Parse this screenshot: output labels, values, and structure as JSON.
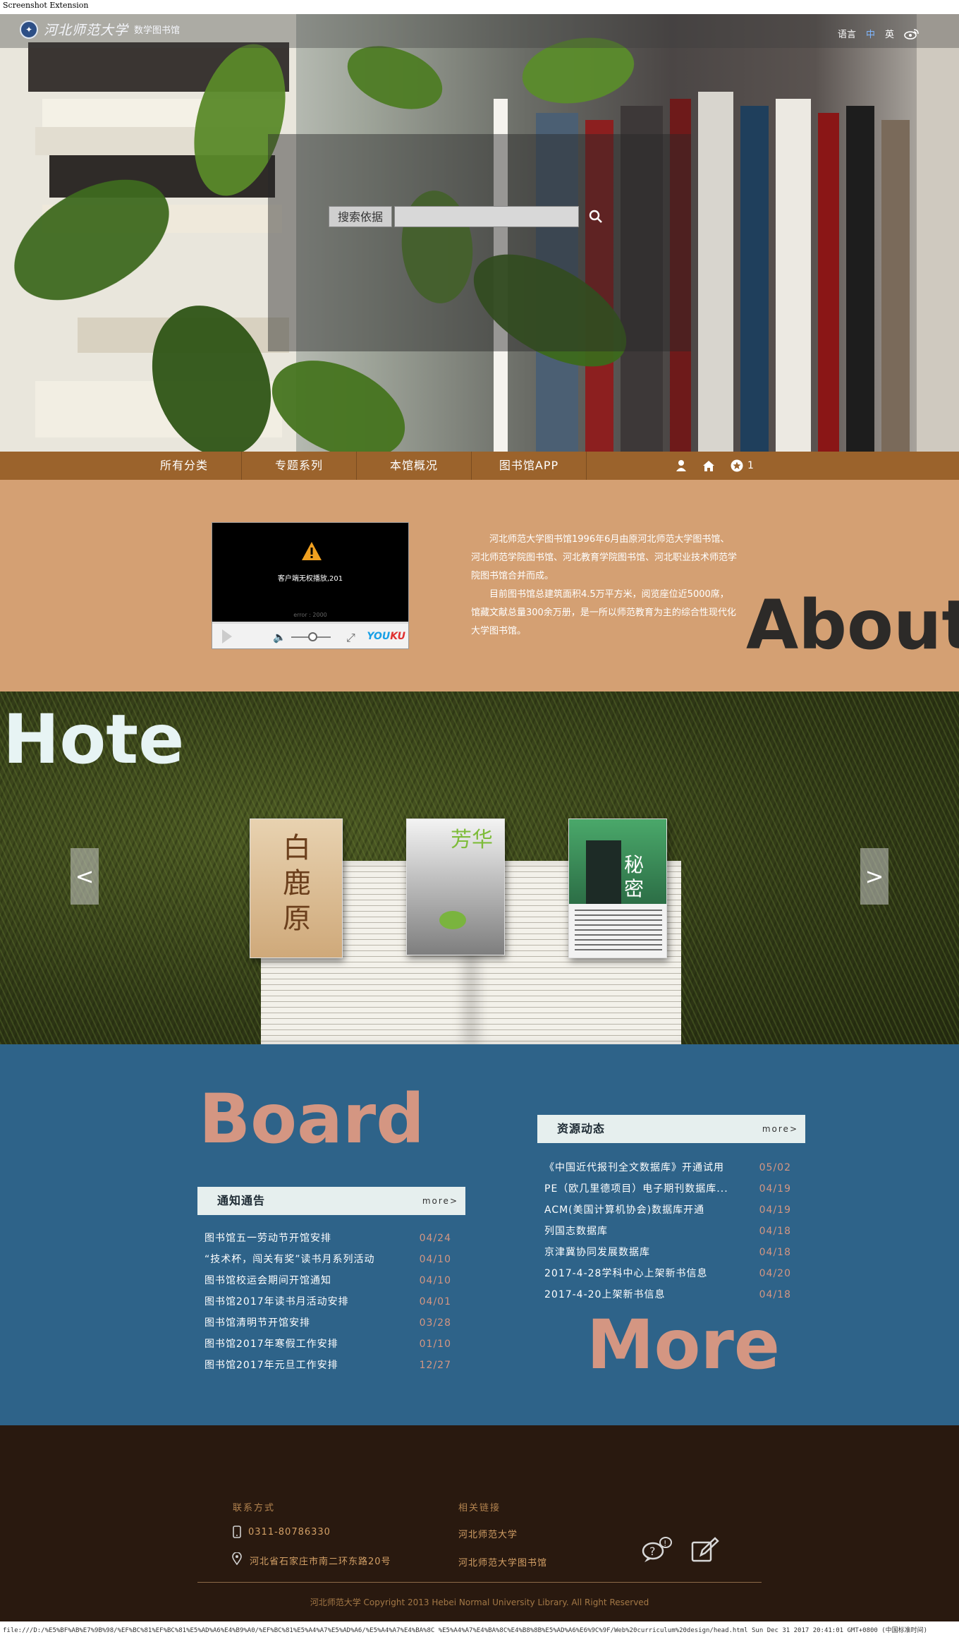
{
  "extension_label": "Screenshot Extension",
  "header": {
    "logo_text": "河北师范大学",
    "logo_sub": "数学图书馆",
    "lang_label": "语言",
    "lang_zh": "中",
    "lang_en": "英"
  },
  "search": {
    "label": "搜索依据",
    "placeholder": ""
  },
  "nav": {
    "items": [
      "所有分类",
      "专题系列",
      "本馆概况",
      "图书馆APP"
    ],
    "favorites_count": "1"
  },
  "about": {
    "title": "About",
    "video_message": "客户端无权播放,201",
    "video_sub": "error : 2000",
    "video_brand_a": "YOU",
    "video_brand_b": "KU",
    "paragraph1": "河北师范大学图书馆1996年6月由原河北师范大学图书馆、河北师范学院图书馆、河北教育学院图书馆、河北职业技术师范学院图书馆合并而成。",
    "paragraph2": "目前图书馆总建筑面积4.5万平方米，阅览座位近5000席，馆藏文献总量300余万册，是一所以师范教育为主的综合性现代化大学图书馆。"
  },
  "hote": {
    "title": "Hote",
    "book1_title": "白鹿原",
    "book2_title": "芳华",
    "book3_title": "秘密",
    "prev": "<",
    "next": ">"
  },
  "board": {
    "title": "Board",
    "more_title": "More",
    "notices": {
      "heading": "通知通告",
      "more": "more>",
      "items": [
        {
          "title": "图书馆五一劳动节开馆安排",
          "date": "04/24"
        },
        {
          "title": "“技术杯，闯关有奖”读书月系列活动",
          "date": "04/10"
        },
        {
          "title": "图书馆校运会期间开馆通知",
          "date": "04/10"
        },
        {
          "title": "图书馆2017年读书月活动安排",
          "date": "04/01"
        },
        {
          "title": "图书馆清明节开馆安排",
          "date": "03/28"
        },
        {
          "title": "图书馆2017年寒假工作安排",
          "date": "01/10"
        },
        {
          "title": "图书馆2017年元旦工作安排",
          "date": "12/27"
        }
      ]
    },
    "resources": {
      "heading": "资源动态",
      "more": "more>",
      "items": [
        {
          "title": "《中国近代报刊全文数据库》开通试用",
          "date": "05/02"
        },
        {
          "title": "PE（欧几里德项目）电子期刊数据库...",
          "date": "04/19"
        },
        {
          "title": "ACM(美国计算机协会)数据库开通",
          "date": "04/19"
        },
        {
          "title": "列国志数据库",
          "date": "04/18"
        },
        {
          "title": "京津冀协同发展数据库",
          "date": "04/18"
        },
        {
          "title": "2017-4-28学科中心上架新书信息",
          "date": "04/20"
        },
        {
          "title": "2017-4-20上架新书信息",
          "date": "04/18"
        }
      ]
    }
  },
  "footer": {
    "contact_heading": "联系方式",
    "phone": "0311-80786330",
    "address": "河北省石家庄市南二环东路20号",
    "links_heading": "相关链接",
    "link1": "河北师范大学",
    "link2": "河北师范大学图书馆",
    "copyright": "河北师范大学 Copyright 2013 Hebei Normal University Library. All Right Reserved"
  },
  "statusbar": {
    "text": "file:///D:/%E5%BF%AB%E7%9B%98/%EF%BC%81%EF%BC%81%E5%AD%A6%E4%B9%A0/%EF%BC%81%E5%A4%A7%E5%AD%A6/%E5%A4%A7%E4%BA%8C %E5%A4%A7%E4%BA%8C%E4%B8%8B%E5%AD%A6%E6%9C%9F/Web%20curriculum%20design/head.html Sun Dec 31 2017 20:41:01 GMT+0800 (中国标准时间)"
  },
  "colors": {
    "nav_brown": "#9b632c",
    "about_tan": "#d4a073",
    "board_blue": "#2e6389",
    "accent_salmon": "#d49682",
    "footer_dark": "#29190f"
  }
}
